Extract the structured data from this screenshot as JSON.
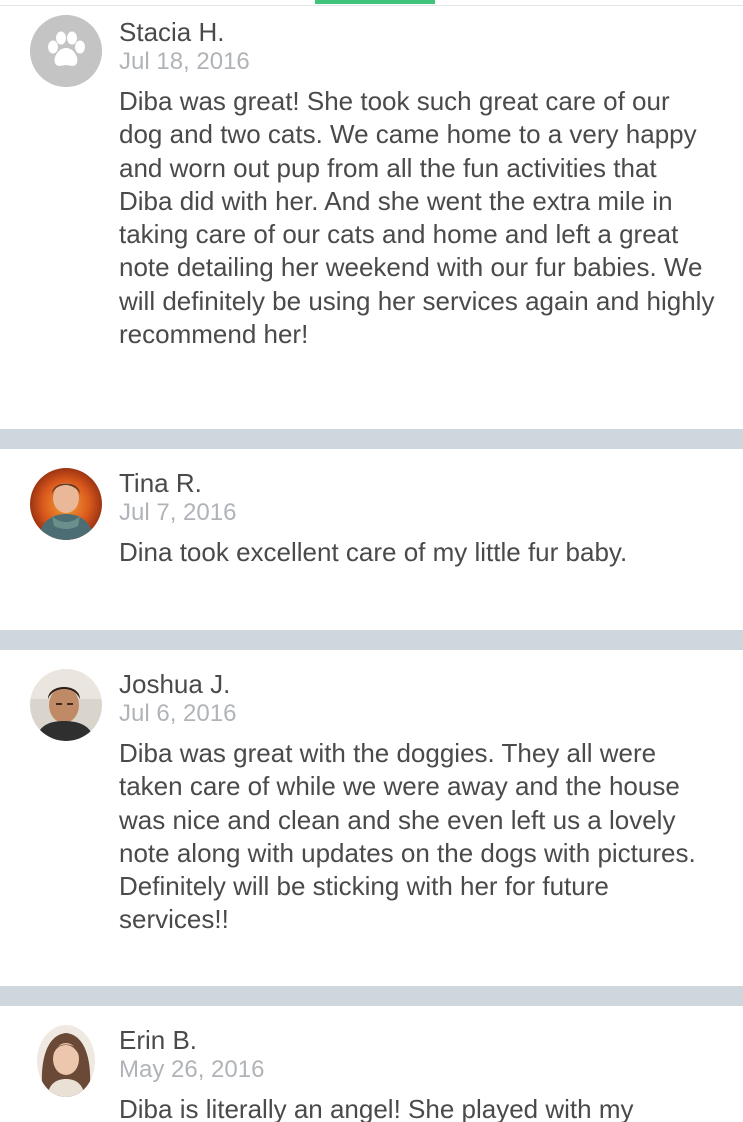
{
  "colors": {
    "accent": "#3fc57a",
    "divider": "#ced7de",
    "text": "#4a4a4a",
    "date": "#b0b4b8"
  },
  "reviews": [
    {
      "name": "Stacia H.",
      "date": "Jul 18, 2016",
      "avatar_icon": "paw-icon",
      "text": "Diba was great! She took such great care of our dog and two cats. We came home to a very happy and worn out pup from all the fun activities that Diba did with her. And she went the extra mile in taking care of our cats and home and left a great note detailing her weekend with our fur babies. We will definitely be using her services again and highly recommend her!"
    },
    {
      "name": "Tina R.",
      "date": "Jul 7, 2016",
      "avatar_icon": "user-photo",
      "text": "Dina took excellent care of my little fur baby."
    },
    {
      "name": "Joshua J.",
      "date": "Jul 6, 2016",
      "avatar_icon": "user-photo",
      "text": "Diba was great with the doggies. They all were taken care of while we were away and the house was nice and clean and she even left us a lovely note along with updates on the dogs with pictures. Definitely will be sticking with her for future services!!"
    },
    {
      "name": "Erin B.",
      "date": "May 26, 2016",
      "avatar_icon": "user-photo",
      "text": "Diba is literally an angel! She played with my"
    }
  ]
}
